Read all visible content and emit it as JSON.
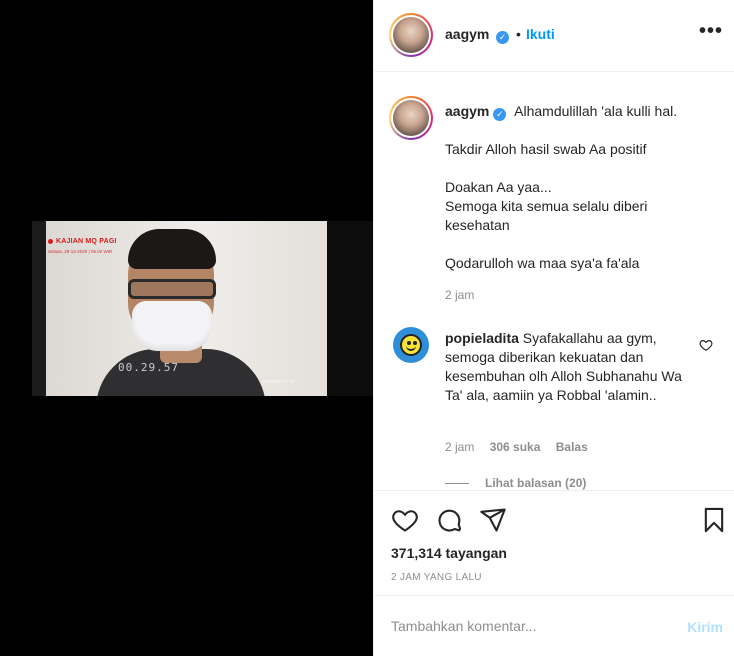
{
  "header": {
    "username": "aagym",
    "separator": "•",
    "follow_label": "Ikuti",
    "more_icon": "•••"
  },
  "media": {
    "program_title": "KAJIAN MQ PAGI",
    "program_date": "Selasa, 29-12-2020 | 05.02 WIB",
    "timer": "00.29.57",
    "property_label": "PROPERTY OF"
  },
  "caption": {
    "username": "aagym",
    "lines": [
      "Alhamdulillah 'ala kulli hal.",
      "",
      "Takdir Alloh hasil swab Aa positif",
      "",
      "Doakan Aa yaa...",
      "Semoga kita semua selalu diberi kesehatan",
      "",
      "Qodarulloh wa maa sya'a fa'ala"
    ],
    "time": "2 jam"
  },
  "comment": {
    "username": "popieladita",
    "text": "Syafakallahu aa gym, semoga diberikan kekuatan dan kesembuhan olh Alloh Subhanahu Wa Ta' ala, aamiin ya Robbal 'alamin..",
    "time": "2 jam",
    "likes": "306 suka",
    "reply_label": "Balas",
    "view_replies": "Lihat balasan (20)"
  },
  "actions": {
    "views": "371,314 tayangan",
    "posted_ago": "2 JAM YANG LALU"
  },
  "add_comment": {
    "placeholder": "Tambahkan komentar...",
    "post_label": "Kirim"
  },
  "colors": {
    "link_blue": "#0095f6",
    "verified_blue": "#3897f0",
    "disabled_post": "#b2dffc",
    "secondary_text": "#8e8e8e"
  }
}
